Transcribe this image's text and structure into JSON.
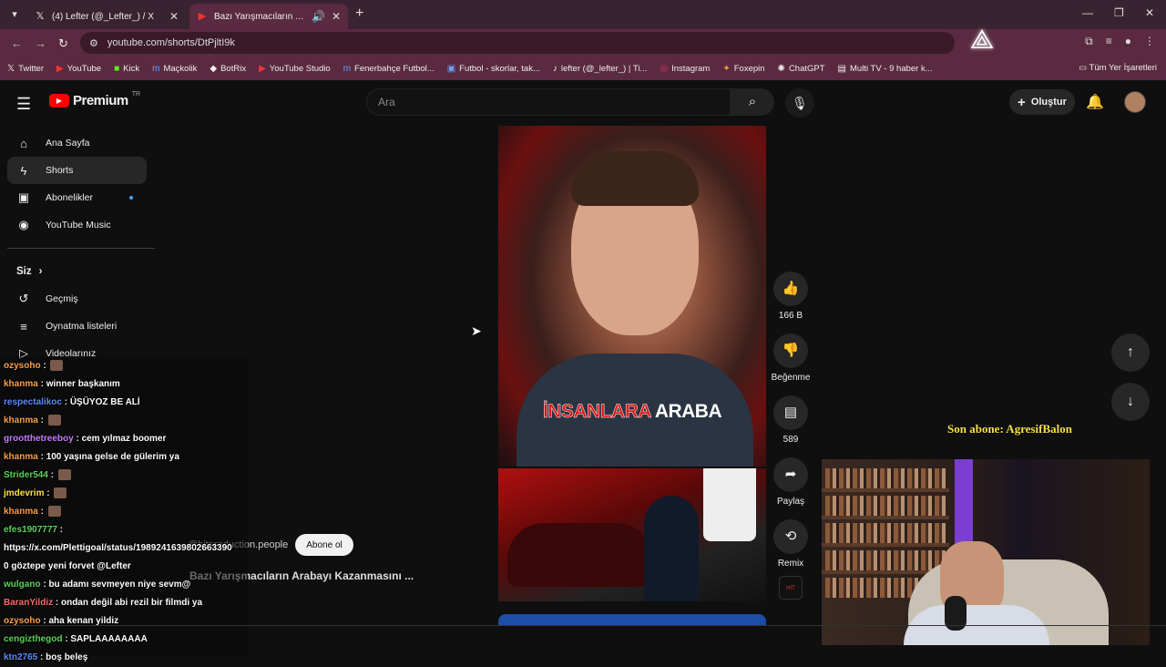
{
  "browser": {
    "tabs": [
      {
        "title": "(4) Lefter (@_Lefter_) / X",
        "icon": "x-logo-icon"
      },
      {
        "title": "Bazı Yarışmacıların Arabayı",
        "icon": "youtube-icon"
      }
    ],
    "url": "youtube.com/shorts/DtPjltI9k",
    "bookmarks": [
      {
        "label": "Twitter",
        "icon": "x-logo-icon"
      },
      {
        "label": "YouTube",
        "icon": "youtube-icon"
      },
      {
        "label": "Kick",
        "icon": "kick-icon"
      },
      {
        "label": "Maçkolik",
        "icon": "mackolik-icon"
      },
      {
        "label": "BotRix",
        "icon": "botrix-icon"
      },
      {
        "label": "YouTube Studio",
        "icon": "youtube-icon"
      },
      {
        "label": "Fenerbahçe Futbol...",
        "icon": "mackolik-icon"
      },
      {
        "label": "Futbol - skorlar, tak...",
        "icon": "flashscore-icon"
      },
      {
        "label": "lefter (@_lefter_) | Ti...",
        "icon": "tiktok-icon"
      },
      {
        "label": "Instagram",
        "icon": "instagram-icon"
      },
      {
        "label": "Foxepin",
        "icon": "foxepin-icon"
      },
      {
        "label": "ChatGPT",
        "icon": "chatgpt-icon"
      },
      {
        "label": "Multi TV - 9 haber k...",
        "icon": "multitv-icon"
      }
    ],
    "bookmarks_right": "Tüm Yer İşaretleri"
  },
  "youtube": {
    "logo_text": "Premium",
    "country": "TR",
    "search_placeholder": "Ara",
    "create_label": "Oluştur",
    "sidebar": {
      "main": [
        {
          "label": "Ana Sayfa",
          "icon": "home-icon"
        },
        {
          "label": "Shorts",
          "icon": "shorts-icon",
          "active": true
        },
        {
          "label": "Abonelikler",
          "icon": "subscriptions-icon",
          "dot": true
        },
        {
          "label": "YouTube Music",
          "icon": "music-icon"
        }
      ],
      "you_section": "Siz",
      "you_items": [
        {
          "label": "Geçmiş",
          "icon": "history-icon"
        },
        {
          "label": "Oynatma listeleri",
          "icon": "playlist-icon"
        },
        {
          "label": "Videolarınız",
          "icon": "video-icon"
        }
      ]
    },
    "video": {
      "caption_red": "İNSANLARA",
      "caption_white": "ARABA",
      "channel": "@hitproduction.people",
      "subscribe": "Abone ol",
      "title": "Bazı Yarışmacıların Arabayı Kazanmasını ..."
    },
    "actions": {
      "like_count": "166 B",
      "dislike_label": "Beğenme",
      "comment_count": "589",
      "share_label": "Paylaş",
      "remix_label": "Remix"
    }
  },
  "stream_overlay": {
    "chat": [
      {
        "user": "ozysoho",
        "color": "#ff9f3f",
        "msg": "",
        "emote": true
      },
      {
        "user": "khanma",
        "color": "#ff9f3f",
        "msg": "winner başkanım"
      },
      {
        "user": "respectalikoc",
        "color": "#5b8cff",
        "msg": "ÜŞÜYOZ BE ALİ"
      },
      {
        "user": "khanma",
        "color": "#ff9f3f",
        "msg": "",
        "emote": true
      },
      {
        "user": "grootthetreeboy",
        "color": "#c87cff",
        "msg": "cem yılmaz boomer"
      },
      {
        "user": "khanma",
        "color": "#ff9f3f",
        "msg": "100 yaşına gelse de gülerim ya"
      },
      {
        "user": "Strider544",
        "color": "#5bd25b",
        "msg": "",
        "emote": true
      },
      {
        "user": "jmdevrim",
        "color": "#ffe24a",
        "msg": "",
        "emote": true
      },
      {
        "user": "khanma",
        "color": "#ff9f3f",
        "msg": "",
        "emote": true
      },
      {
        "user": "efes1907777",
        "color": "#5bd25b",
        "msg": ""
      },
      {
        "user": "",
        "color": "#ffffff",
        "msg": "https://x.com/Plettigoal/status/1989241639802663390"
      },
      {
        "user": "",
        "color": "#ffffff",
        "msg": "0 göztepe yeni forvet @Lefter"
      },
      {
        "user": "wulgano",
        "color": "#5bd25b",
        "msg": "bu adamı sevmeyen niye sevm@"
      },
      {
        "user": "BaranYildiz",
        "color": "#ff6b6b",
        "msg": "ondan değil abi rezil bir filmdi ya"
      },
      {
        "user": "ozysoho",
        "color": "#ff9f3f",
        "msg": "aha kenan yildiz"
      },
      {
        "user": "cengizthegod",
        "color": "#5bd25b",
        "msg": "SAPLAAAAAAAA"
      },
      {
        "user": "ktn2765",
        "color": "#5b8cff",
        "msg": "boş beleş"
      }
    ],
    "last_sub": "Son abone: AgresifBalon"
  }
}
